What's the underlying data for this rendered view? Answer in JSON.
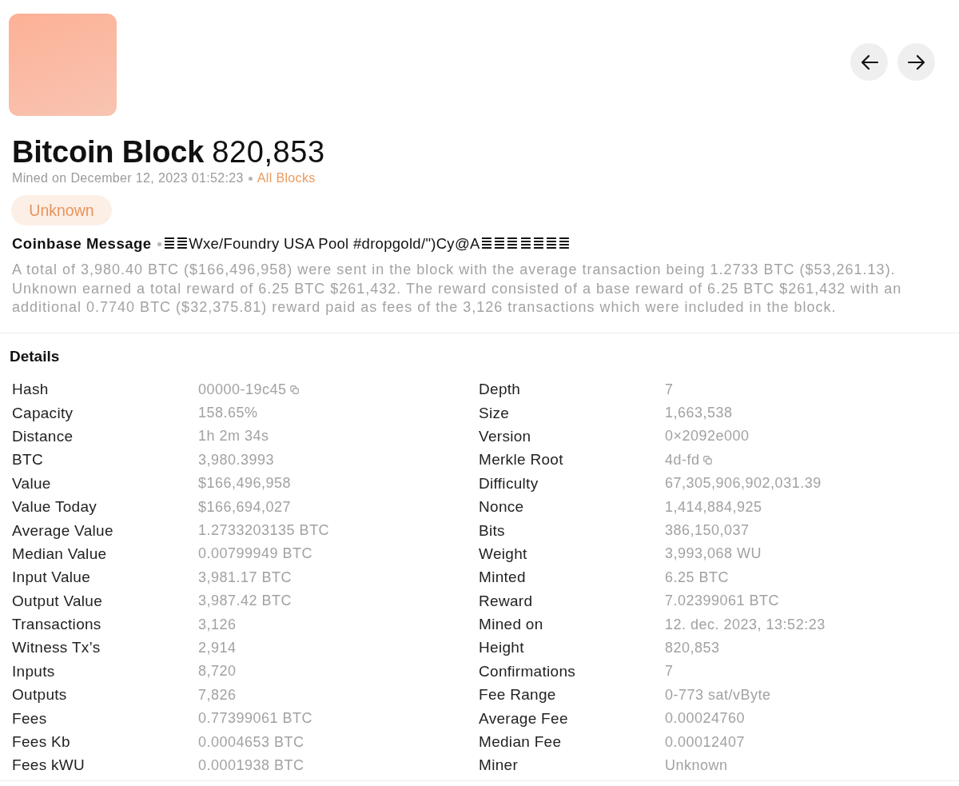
{
  "header": {
    "title": "Bitcoin Block",
    "number": "820,853",
    "mined": "Mined on December 12, 2023 01:52:23",
    "link": "All Blocks",
    "badge": "Unknown"
  },
  "coinbase": {
    "label": "Coinbase Message",
    "message": "≣≣Wxe/Foundry USA Pool #dropgold/\")Cy@A≣≣≣≣≣≣≣"
  },
  "summary": "A total of 3,980.40 BTC ($166,496,958) were sent in the block with the average transaction being 1.2733 BTC ($53,261.13). Unknown earned a total reward of 6.25 BTC $261,432. The reward consisted of a base reward of 6.25 BTC $261,432 with an additional 0.7740 BTC ($32,375.81) reward paid as fees of the 3,126 transactions which were included in the block.",
  "details": {
    "title": "Details",
    "left": [
      {
        "label": "Hash",
        "value": "00000-19c45",
        "copyable": true
      },
      {
        "label": "Capacity",
        "value": "158.65%",
        "copyable": false
      },
      {
        "label": "Distance",
        "value": "1h 2m 34s",
        "copyable": false
      },
      {
        "label": "BTC",
        "value": "3,980.3993",
        "copyable": false
      },
      {
        "label": "Value",
        "value": "$166,496,958",
        "copyable": false
      },
      {
        "label": "Value Today",
        "value": "$166,694,027",
        "copyable": false
      },
      {
        "label": "Average Value",
        "value": "1.2733203135 BTC",
        "copyable": false
      },
      {
        "label": "Median Value",
        "value": "0.00799949 BTC",
        "copyable": false
      },
      {
        "label": "Input Value",
        "value": "3,981.17 BTC",
        "copyable": false
      },
      {
        "label": "Output Value",
        "value": "3,987.42 BTC",
        "copyable": false
      },
      {
        "label": "Transactions",
        "value": "3,126",
        "copyable": false
      },
      {
        "label": "Witness Tx’s",
        "value": "2,914",
        "copyable": false
      },
      {
        "label": "Inputs",
        "value": "8,720",
        "copyable": false
      },
      {
        "label": "Outputs",
        "value": "7,826",
        "copyable": false
      },
      {
        "label": "Fees",
        "value": "0.77399061 BTC",
        "copyable": false
      },
      {
        "label": "Fees Kb",
        "value": "0.0004653 BTC",
        "copyable": false
      },
      {
        "label": "Fees kWU",
        "value": "0.0001938 BTC",
        "copyable": false
      }
    ],
    "right": [
      {
        "label": "Depth",
        "value": "7",
        "copyable": false
      },
      {
        "label": "Size",
        "value": "1,663,538",
        "copyable": false
      },
      {
        "label": "Version",
        "value": "0×2092e000",
        "copyable": false
      },
      {
        "label": "Merkle Root",
        "value": "4d-fd",
        "copyable": true
      },
      {
        "label": "Difficulty",
        "value": "67,305,906,902,031.39",
        "copyable": false
      },
      {
        "label": "Nonce",
        "value": "1,414,884,925",
        "copyable": false
      },
      {
        "label": "Bits",
        "value": "386,150,037",
        "copyable": false
      },
      {
        "label": "Weight",
        "value": "3,993,068 WU",
        "copyable": false
      },
      {
        "label": "Minted",
        "value": "6.25 BTC",
        "copyable": false
      },
      {
        "label": "Reward",
        "value": "7.02399061 BTC",
        "copyable": false
      },
      {
        "label": "Mined on",
        "value": "12. dec. 2023, 13:52:23",
        "copyable": false
      },
      {
        "label": "Height",
        "value": "820,853",
        "copyable": false
      },
      {
        "label": "Confirmations",
        "value": "7",
        "copyable": false
      },
      {
        "label": "Fee Range",
        "value": "0-773 sat/vByte",
        "copyable": false
      },
      {
        "label": "Average Fee",
        "value": "0.00024760",
        "copyable": false
      },
      {
        "label": "Median Fee",
        "value": "0.00012407",
        "copyable": false
      },
      {
        "label": "Miner",
        "value": "Unknown",
        "copyable": false
      }
    ]
  }
}
